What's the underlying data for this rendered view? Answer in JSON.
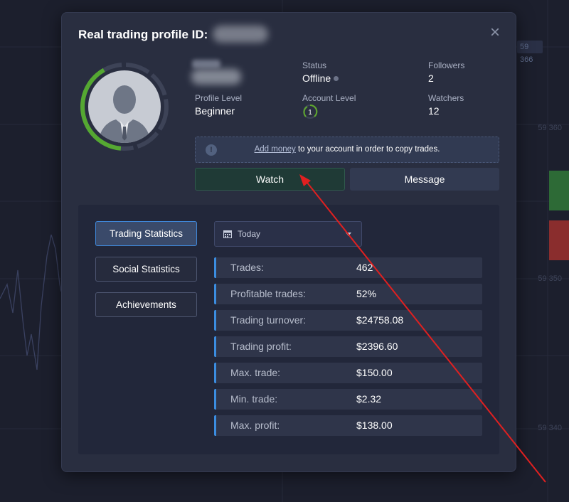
{
  "background": {
    "price_labels": [
      "59 366",
      "59 360",
      "59 350",
      "59 340"
    ]
  },
  "modal": {
    "title": "Real trading profile ID:",
    "close_symbol": "×",
    "profile": {
      "status_label": "Status",
      "status_value": "Offline",
      "followers_label": "Followers",
      "followers_value": "2",
      "profile_level_label": "Profile Level",
      "profile_level_value": "Beginner",
      "account_level_label": "Account Level",
      "account_level_value": "1",
      "watchers_label": "Watchers",
      "watchers_value": "12"
    },
    "notice": {
      "link": "Add money",
      "text": " to your account in order to copy trades."
    },
    "buttons": {
      "watch": "Watch",
      "message": "Message"
    },
    "tabs": [
      {
        "label": "Trading Statistics",
        "active": true
      },
      {
        "label": "Social Statistics",
        "active": false
      },
      {
        "label": "Achievements",
        "active": false
      }
    ],
    "period": "Today",
    "stats": [
      {
        "label": "Trades:",
        "value": "462"
      },
      {
        "label": "Profitable trades:",
        "value": "52%"
      },
      {
        "label": "Trading turnover:",
        "value": "$24758.08"
      },
      {
        "label": "Trading profit:",
        "value": "$2396.60"
      },
      {
        "label": "Max. trade:",
        "value": "$150.00"
      },
      {
        "label": "Min. trade:",
        "value": "$2.32"
      },
      {
        "label": "Max. profit:",
        "value": "$138.00"
      }
    ]
  },
  "colors": {
    "accent_blue": "#3b8de0",
    "level_green": "#5fa82e",
    "annotation_red": "#e02020"
  },
  "icons": {
    "close": "close-icon",
    "avatar": "user-avatar-icon",
    "info": "info-icon",
    "calendar": "calendar-icon",
    "dropdown": "chevron-down-icon"
  }
}
